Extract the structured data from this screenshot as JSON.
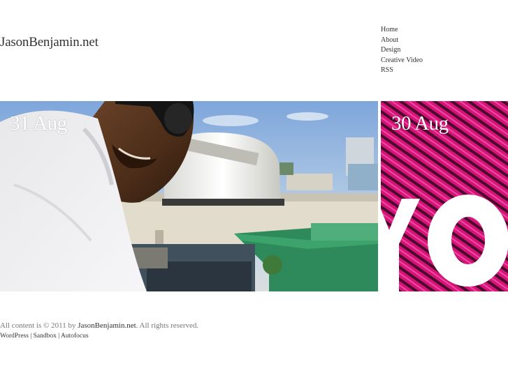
{
  "site": {
    "title": "JasonBenjamin.net"
  },
  "nav": {
    "items": [
      {
        "label": "Home"
      },
      {
        "label": "About"
      },
      {
        "label": "Design"
      },
      {
        "label": "Creative Video"
      },
      {
        "label": "RSS"
      }
    ]
  },
  "posts": [
    {
      "date": "31 Aug"
    },
    {
      "date": "30 Aug"
    }
  ],
  "footer": {
    "prefix": "All content is © 2011 by ",
    "site_link": "JasonBenjamin.net",
    "suffix": ". All rights reserved.",
    "links": [
      {
        "label": "WordPress"
      },
      {
        "label": "Sandbox"
      },
      {
        "label": "Autofocus"
      }
    ],
    "separator": " | "
  },
  "colors": {
    "accent_magenta": "#d4147a",
    "sky_blue": "#8fb4e3",
    "roof_green": "#2e8a5a"
  }
}
